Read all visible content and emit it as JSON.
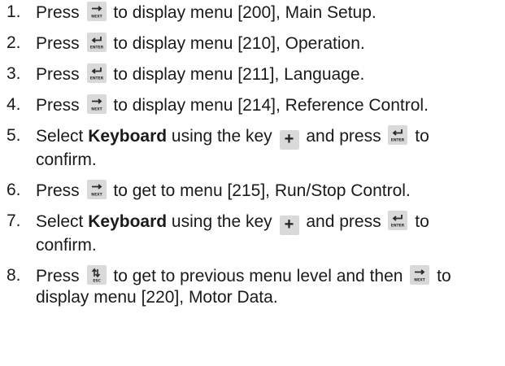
{
  "keys": {
    "next": "NEXT",
    "enter": "ENTER",
    "esc": "ESC",
    "plus": "+"
  },
  "steps": [
    {
      "num": "1.",
      "parts": [
        "Press",
        "to display menu [200], Main Setup."
      ]
    },
    {
      "num": "2.",
      "parts": [
        "Press",
        "to display menu [210], Operation."
      ]
    },
    {
      "num": "3.",
      "parts": [
        "Press",
        "to display menu [211], Language."
      ]
    },
    {
      "num": "4.",
      "parts": [
        "Press",
        "to display menu [214], Reference Control."
      ]
    },
    {
      "num": "5.",
      "parts": [
        "Select",
        "Keyboard",
        "using the key",
        "and press",
        "to confirm."
      ]
    },
    {
      "num": "6.",
      "parts": [
        "Press",
        "to get to menu [215], Run/Stop Control."
      ]
    },
    {
      "num": "7.",
      "parts": [
        "Select",
        "Keyboard",
        "using the key",
        "and press",
        "to confirm."
      ]
    },
    {
      "num": "8.",
      "parts": [
        "Press",
        "to get to previous menu level and then",
        "to display menu [220], Motor Data."
      ]
    }
  ]
}
